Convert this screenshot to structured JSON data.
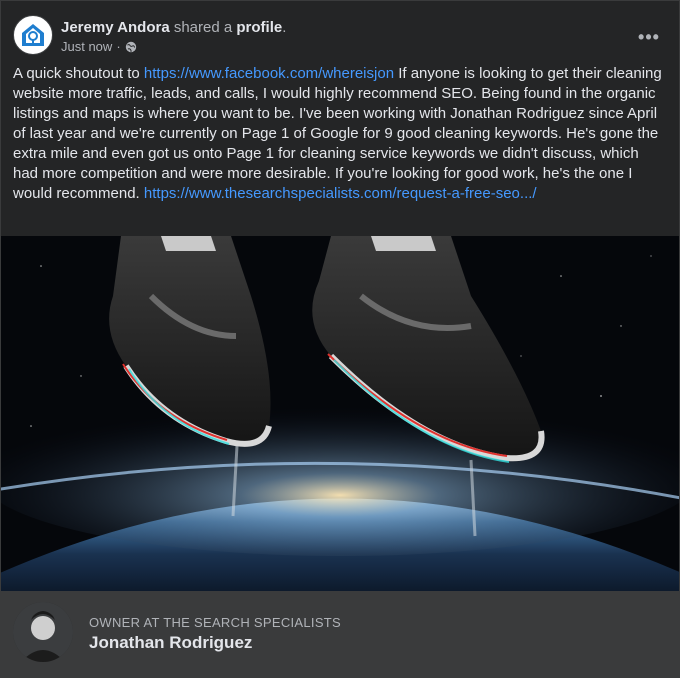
{
  "post": {
    "author": "Jeremy Andora",
    "verb": "shared a",
    "object": "profile",
    "object_suffix": ".",
    "timestamp": "Just now",
    "separator": "·",
    "privacy_icon": "globe-icon",
    "more_icon": "more-options-icon",
    "more_label": "•••"
  },
  "text": {
    "p1": "A quick shoutout to ",
    "link1": "https://www.facebook.com/whereisjon",
    "p2": " If anyone is looking to get their cleaning website more traffic, leads, and calls, I would highly recommend SEO. Being found in the organic listings and maps is where you want to be. I've been working with Jonathan Rodriguez since April of last year and we're currently on Page 1 of Google for 9 good cleaning keywords. He's gone the extra mile and even got us onto Page 1 for cleaning service keywords we didn't discuss, which had more competition and were more desirable. If you're looking for good work, he's the one I would recommend. ",
    "link2": "https://www.thesearchspecialists.com/request-a-free-seo.../"
  },
  "shared_profile": {
    "subtitle": "OWNER AT THE SEARCH SPECIALISTS",
    "name": "Jonathan Rodriguez"
  },
  "colors": {
    "card_bg": "#242526",
    "footer_bg": "#3a3b3c",
    "link": "#4599ff",
    "text_primary": "#e4e6eb",
    "text_secondary": "#b0b3b8"
  }
}
